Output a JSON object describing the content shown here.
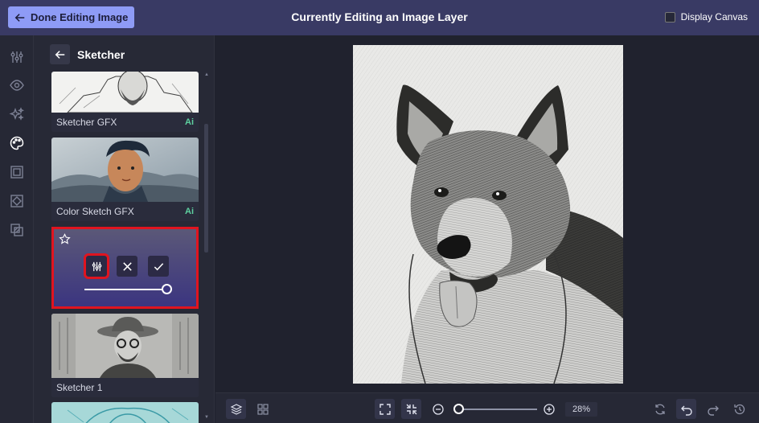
{
  "topbar": {
    "done_label": "Done Editing Image",
    "title": "Currently Editing an Image Layer",
    "display_canvas_label": "Display Canvas",
    "display_canvas_checked": false
  },
  "rail": {
    "icons": [
      "adjustments-icon",
      "eye-icon",
      "magic-sparkle-icon",
      "palette-icon",
      "frame-icon",
      "texture-icon",
      "overlay-icon"
    ],
    "active": "palette-icon"
  },
  "panel": {
    "title": "Sketcher",
    "cards": [
      {
        "label": "Sketcher GFX",
        "badge": "Ai"
      },
      {
        "label": "Color Sketch GFX",
        "badge": "Ai"
      },
      {
        "label": "Sketcher 1",
        "badge": ""
      }
    ],
    "active_card": {
      "intensity": 1.0
    }
  },
  "bottombar": {
    "zoom_value": "28%",
    "zoom_level": 0.28
  },
  "colors": {
    "topbar": "#393a64",
    "accent_button": "#8e9bf6",
    "highlight": "#e0141f",
    "ai_badge": "#5ed1a0"
  }
}
